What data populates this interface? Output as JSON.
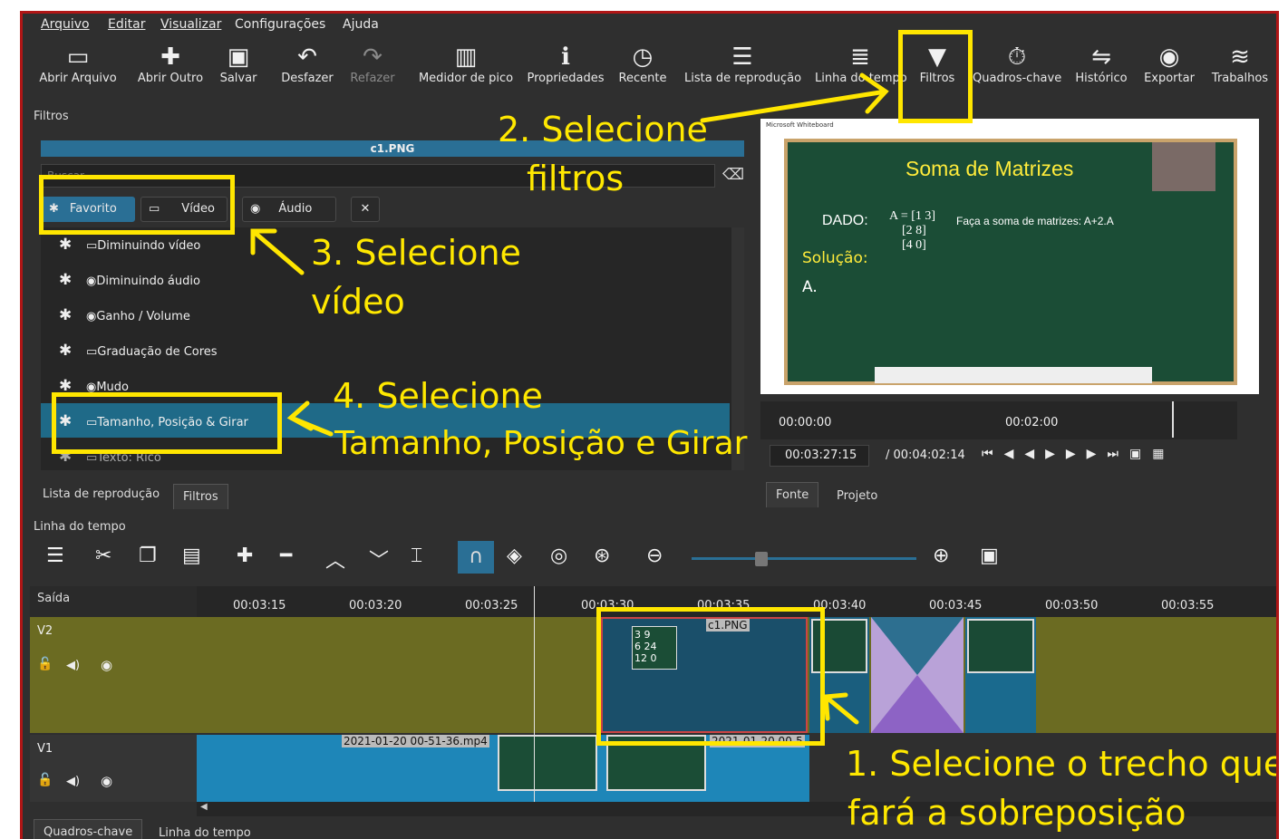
{
  "menu": [
    "Arquivo",
    "Editar",
    "Visualizar",
    "Configurações",
    "Ajuda"
  ],
  "toolbar": {
    "open": "Abrir Arquivo",
    "open_other": "Abrir Outro",
    "save": "Salvar",
    "undo": "Desfazer",
    "redo": "Refazer",
    "peak": "Medidor de pico",
    "props": "Propriedades",
    "recent": "Recente",
    "playlist": "Lista de reprodução",
    "timeline": "Linha do tempo",
    "filters": "Filtros",
    "keyframes": "Quadros-chave",
    "history": "Histórico",
    "export": "Exportar",
    "jobs": "Trabalhos"
  },
  "filters_panel": {
    "title": "Filtros",
    "clip_name": "c1.PNG",
    "search_placeholder": "Buscar",
    "tab_favorite": "Favorito",
    "tab_video": "Vídeo",
    "tab_audio": "Áudio",
    "items": [
      "Diminuindo vídeo",
      "Diminuindo áudio",
      "Ganho / Volume",
      "Graduação de Cores",
      "Mudo",
      "Tamanho, Posição & Girar",
      "Texto: Rico"
    ]
  },
  "left_tabs": [
    "Lista de reprodução",
    "Filtros"
  ],
  "player": {
    "window_title": "Microsoft Whiteboard",
    "board_title": "Soma de Matrizes",
    "board_dado": "DADO:",
    "board_task": "Faça a soma de matrizes: A+2.A",
    "board_solution": "Solução:",
    "board_a": "A.",
    "ruler_t1": "00:00:00",
    "ruler_t2": "00:02:00",
    "position": "00:03:27:15",
    "duration": "/ 00:04:02:14"
  },
  "right_tabs": [
    "Fonte",
    "Projeto"
  ],
  "timeline": {
    "title": "Linha do tempo",
    "output": "Saída",
    "ticks": [
      "00:03:15",
      "00:03:20",
      "00:03:25",
      "00:03:30",
      "00:03:35",
      "00:03:40",
      "00:03:45",
      "00:03:50",
      "00:03:55"
    ],
    "v2": "V2",
    "v1": "V1",
    "clip_v2": "c1.PNG",
    "clip_v1": "2021-01-20 00-51-36.mp4",
    "clip_v1b": "2021-01-20 00-5"
  },
  "bottom_tabs": [
    "Quadros-chave",
    "Linha do tempo"
  ],
  "annotations": {
    "a1": "1. Selecione o trecho que",
    "a1b": "fará a sobreposição",
    "a2": "2. Selecione",
    "a2b": "filtros",
    "a3": "3. Selecione",
    "a3b": "vídeo",
    "a4": "4. Selecione",
    "a4b": "Tamanho, Posição e Girar"
  },
  "colors": {
    "accent": "#2a6f95",
    "highlight": "#ffe600",
    "frame": "#b01616",
    "board": "#1b4d36",
    "track_v2": "#6b6b22",
    "track_v1": "#1e86b8"
  }
}
